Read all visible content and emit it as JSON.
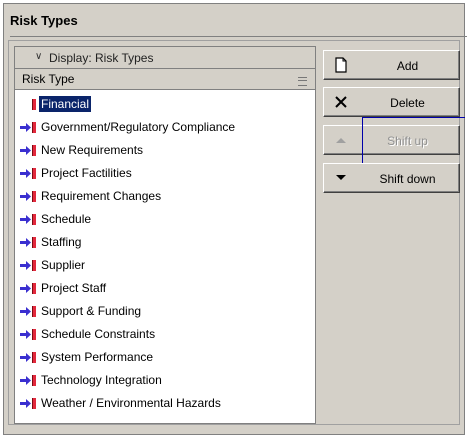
{
  "panel": {
    "title": "Risk Types"
  },
  "list": {
    "display_label": "Display: Risk Types",
    "column_header": "Risk Type",
    "items": [
      {
        "label": "Financial",
        "selected": true
      },
      {
        "label": "Government/Regulatory Compliance"
      },
      {
        "label": "New Requirements"
      },
      {
        "label": "Project Factilities"
      },
      {
        "label": "Requirement Changes"
      },
      {
        "label": "Schedule"
      },
      {
        "label": "Staffing"
      },
      {
        "label": "Supplier"
      },
      {
        "label": "Project Staff"
      },
      {
        "label": "Support & Funding"
      },
      {
        "label": "Schedule Constraints"
      },
      {
        "label": "System Performance"
      },
      {
        "label": "Technology Integration"
      },
      {
        "label": "Weather / Environmental Hazards"
      }
    ]
  },
  "buttons": {
    "add": {
      "label": "Add",
      "icon": "new-page-icon"
    },
    "delete": {
      "label": "Delete",
      "icon": "close-x-icon"
    },
    "shift_up": {
      "label": "Shift up",
      "icon": "triangle-up-icon",
      "enabled": false
    },
    "shift_down": {
      "label": "Shift down",
      "icon": "triangle-down-icon",
      "enabled": true
    }
  },
  "colors": {
    "selection": "#0a246a",
    "arrow": "#3a2fd0",
    "flag": "#e2283c",
    "face": "#d4d0c8"
  }
}
